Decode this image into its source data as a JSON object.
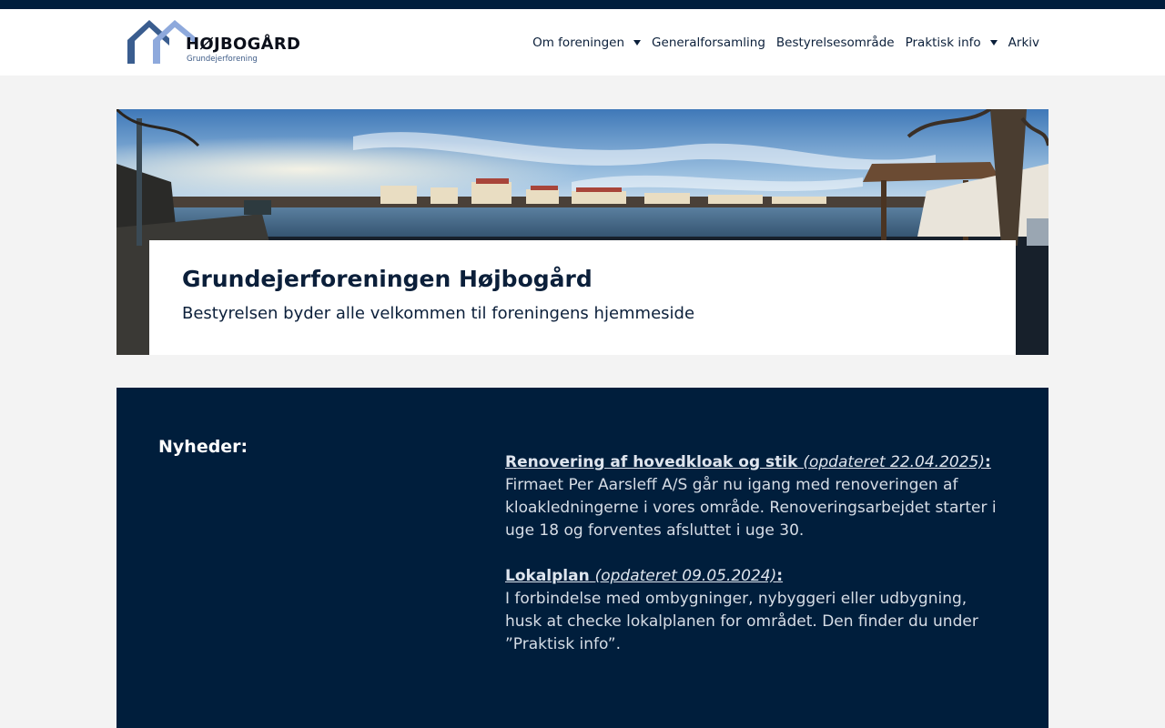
{
  "brand": {
    "name": "HØJBOGÅRD",
    "subtitle": "Grundejerforening",
    "logo_icon": "house-roofs-icon",
    "colors": {
      "navy": "#001e3c",
      "roof_dark": "#3a5d8f",
      "roof_light": "#8ea9dc"
    }
  },
  "nav": {
    "items": [
      {
        "label": "Om foreningen",
        "has_dropdown": true
      },
      {
        "label": "Generalforsamling",
        "has_dropdown": false
      },
      {
        "label": "Bestyrelsesområde",
        "has_dropdown": false
      },
      {
        "label": "Praktisk info",
        "has_dropdown": true
      },
      {
        "label": "Arkiv",
        "has_dropdown": false
      }
    ],
    "dropdown_icon": "caret-down-icon"
  },
  "hero": {
    "title": "Grundejerforeningen Højbogård",
    "subtitle": "Bestyrelsen byder alle velkommen til foreningens hjemmeside"
  },
  "news": {
    "label": "Nyheder:",
    "items": [
      {
        "title": "Renovering af hovedkloak og stik",
        "updated": "(opdateret 22.04.2025)",
        "colon": ":",
        "body": "Firmaet Per Aarsleff A/S går nu igang med renoveringen af kloakledningerne i vores område. Renoveringsarbejdet starter i uge 18 og forventes afsluttet i uge 30."
      },
      {
        "title": "Lokalplan",
        "updated": "(opdateret 09.05.2024)",
        "colon": ":",
        "body": "I forbindelse med ombygninger, nybyggeri eller udbygning, husk at checke lokalplanen for området. Den finder du under ”Praktisk info”."
      }
    ]
  }
}
